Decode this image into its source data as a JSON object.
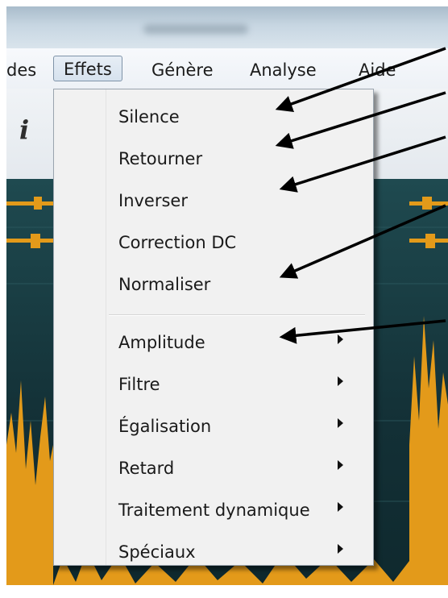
{
  "menubar": {
    "items": [
      "des",
      "Effets",
      "Génère",
      "Analyse",
      "Aide"
    ]
  },
  "toolbar": {
    "info_glyph": "i"
  },
  "dropdown": {
    "items": [
      {
        "label": "Silence",
        "submenu": false
      },
      {
        "label": "Retourner",
        "submenu": false
      },
      {
        "label": "Inverser",
        "submenu": false
      },
      {
        "label": "Correction DC",
        "submenu": false
      },
      {
        "label": "Normaliser",
        "submenu": false
      },
      {
        "label": "Amplitude",
        "submenu": true
      },
      {
        "label": "Filtre",
        "submenu": true
      },
      {
        "label": "Égalisation",
        "submenu": true
      },
      {
        "label": "Retard",
        "submenu": true
      },
      {
        "label": "Traitement dynamique",
        "submenu": true
      },
      {
        "label": "Spéciaux",
        "submenu": true
      }
    ]
  },
  "colors": {
    "waveform": "#e39a1a",
    "waveform_bg": "#16393f",
    "annotation_arrow": "#000000",
    "menu_bg": "#f1f1f1"
  }
}
